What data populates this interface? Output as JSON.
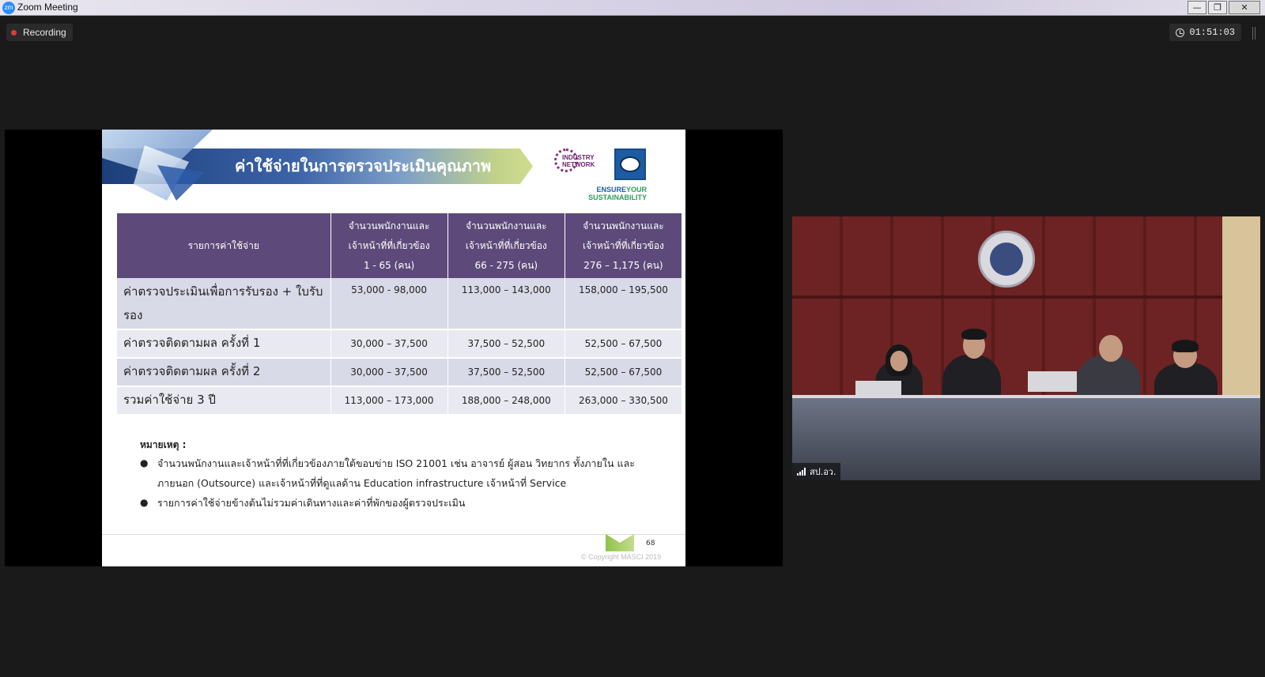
{
  "window": {
    "app_icon": "zm",
    "title": "Zoom Meeting",
    "buttons": {
      "minimize": "—",
      "maximize": "❐",
      "close": "✕"
    }
  },
  "recording": {
    "label": "Recording"
  },
  "timer": {
    "value": "01:51:03"
  },
  "slide": {
    "title": "ค่าใช้จ่ายในการตรวจประเมินคุณภาพ",
    "logo_industry": "INDUSTRY NETWORK",
    "tagline": {
      "part1": "ENSURE",
      "part2": "YOUR",
      "line2": "SUSTAINABILITY"
    },
    "table": {
      "headers": {
        "item": "รายการค่าใช้จ่าย",
        "col1": [
          "จำนวนพนักงานและ",
          "เจ้าหน้าที่ที่เกี่ยวข้อง",
          "1 - 65 (คน)"
        ],
        "col2": [
          "จำนวนพนักงานและ",
          "เจ้าหน้าที่ที่เกี่ยวข้อง",
          "66 - 275 (คน)"
        ],
        "col3": [
          "จำนวนพนักงานและ",
          "เจ้าหน้าที่ที่เกี่ยวข้อง",
          "276 – 1,175 (คน)"
        ]
      },
      "rows": [
        {
          "label": "ค่าตรวจประเมินเพื่อการรับรอง + ใบรับรอง",
          "c1": "53,000 - 98,000",
          "c2": "113,000 – 143,000",
          "c3": "158,000 – 195,500"
        },
        {
          "label": "ค่าตรวจติดตามผล ครั้งที่ 1",
          "c1": "30,000 – 37,500",
          "c2": "37,500 – 52,500",
          "c3": "52,500 – 67,500"
        },
        {
          "label": "ค่าตรวจติดตามผล ครั้งที่ 2",
          "c1": "30,000 – 37,500",
          "c2": "37,500 – 52,500",
          "c3": "52,500 – 67,500"
        },
        {
          "label": "รวมค่าใช้จ่าย 3 ปี",
          "c1": "113,000 – 173,000",
          "c2": "188,000 – 248,000",
          "c3": "263,000 – 330,500"
        }
      ]
    },
    "notes": {
      "title": "หมายเหตุ :",
      "bullet": "●",
      "items": [
        "จำนวนพนักงานและเจ้าหน้าที่ที่เกี่ยวข้องภายใต้ขอบข่าย ISO 21001 เช่น อาจารย์ ผู้สอน วิทยากร ทั้งภายใน และภายนอก (Outsource) และเจ้าหน้าที่ที่ดูแลด้าน Education infrastructure เจ้าหน้าที่ Service",
        "รายการค่าใช้จ่ายข้างต้นไม่รวมค่าเดินทางและค่าที่พักของผู้ตรวจประเมิน"
      ]
    },
    "page_number": "68",
    "copyright": "© Copyright MASCI 2019"
  },
  "participant_video": {
    "name": "สป.อว."
  },
  "colors": {
    "table_header": "#5d4a7a",
    "recording_dot": "#e03a3a",
    "zoom_blue": "#2d8cff"
  }
}
